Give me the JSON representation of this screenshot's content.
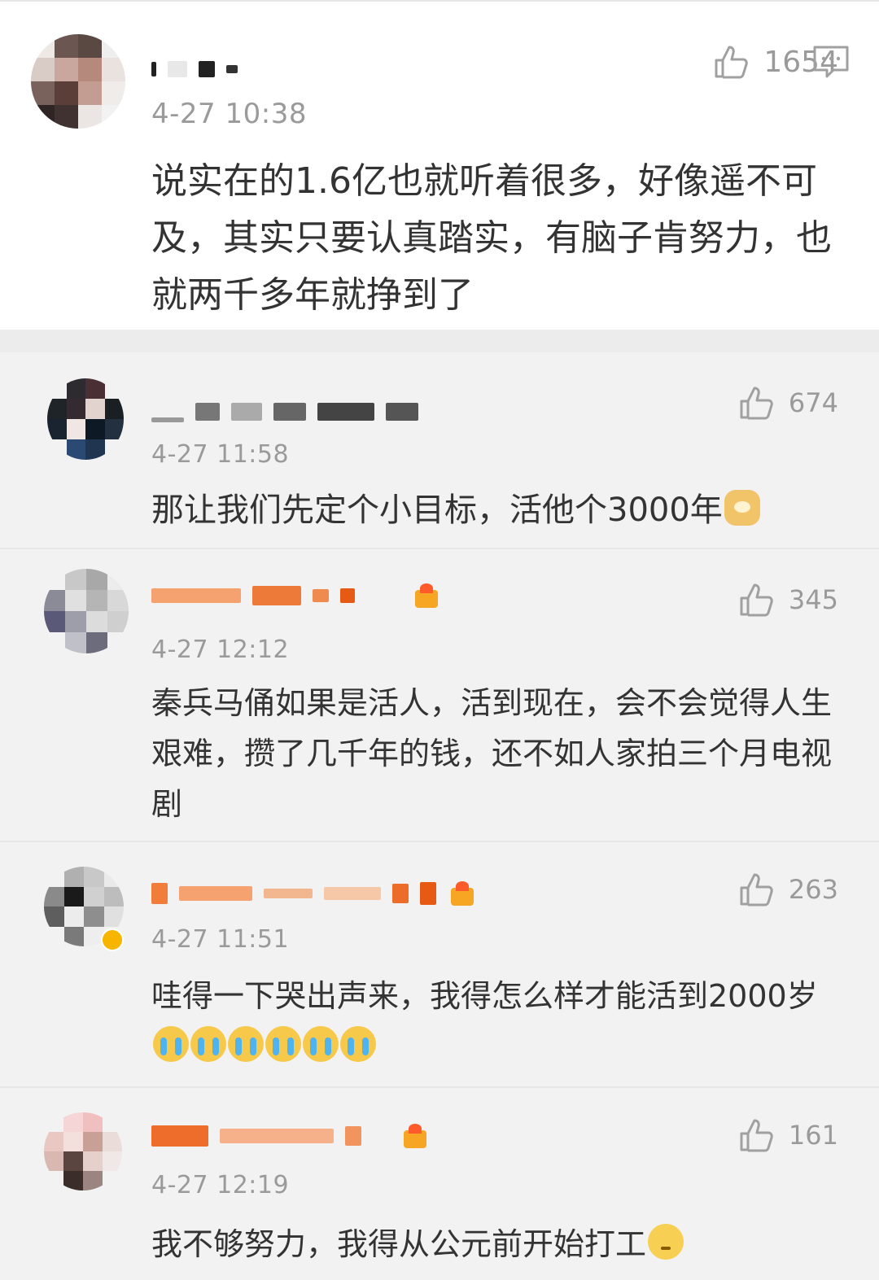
{
  "colors": {
    "text": "#333333",
    "meta": "#9a9a9a",
    "page_bg": "#f2f2f2",
    "card_bg": "#ffffff"
  },
  "icons": {
    "like": "thumbs-up-icon",
    "comment": "comment-icon"
  },
  "main_comment": {
    "time": "4-27 10:38",
    "likes": "1654",
    "text": "说实在的1.6亿也就听着很多，好像遥不可及，其实只要认真踏实，有脑子肯努力，也就两千多年就挣到了"
  },
  "replies": [
    {
      "time": "4-27 11:58",
      "likes": "674",
      "text": "那让我们先定个小目标，活他个3000年",
      "emojis": [
        "doge"
      ]
    },
    {
      "time": "4-27 12:12",
      "likes": "345",
      "text": "秦兵马俑如果是活人，活到现在，会不会觉得人生艰难，攒了几千年的钱，还不如人家拍三个月电视剧",
      "emojis": []
    },
    {
      "time": "4-27 11:51",
      "likes": "263",
      "text": "哇得一下哭出声来，我得怎么样才能活到2000岁",
      "emojis": [
        "cry",
        "cry",
        "cry",
        "cry",
        "cry",
        "cry"
      ]
    },
    {
      "time": "4-27 12:19",
      "likes": "161",
      "text": "我不够努力，我得从公元前开始打工",
      "emojis": [
        "meh"
      ]
    }
  ]
}
